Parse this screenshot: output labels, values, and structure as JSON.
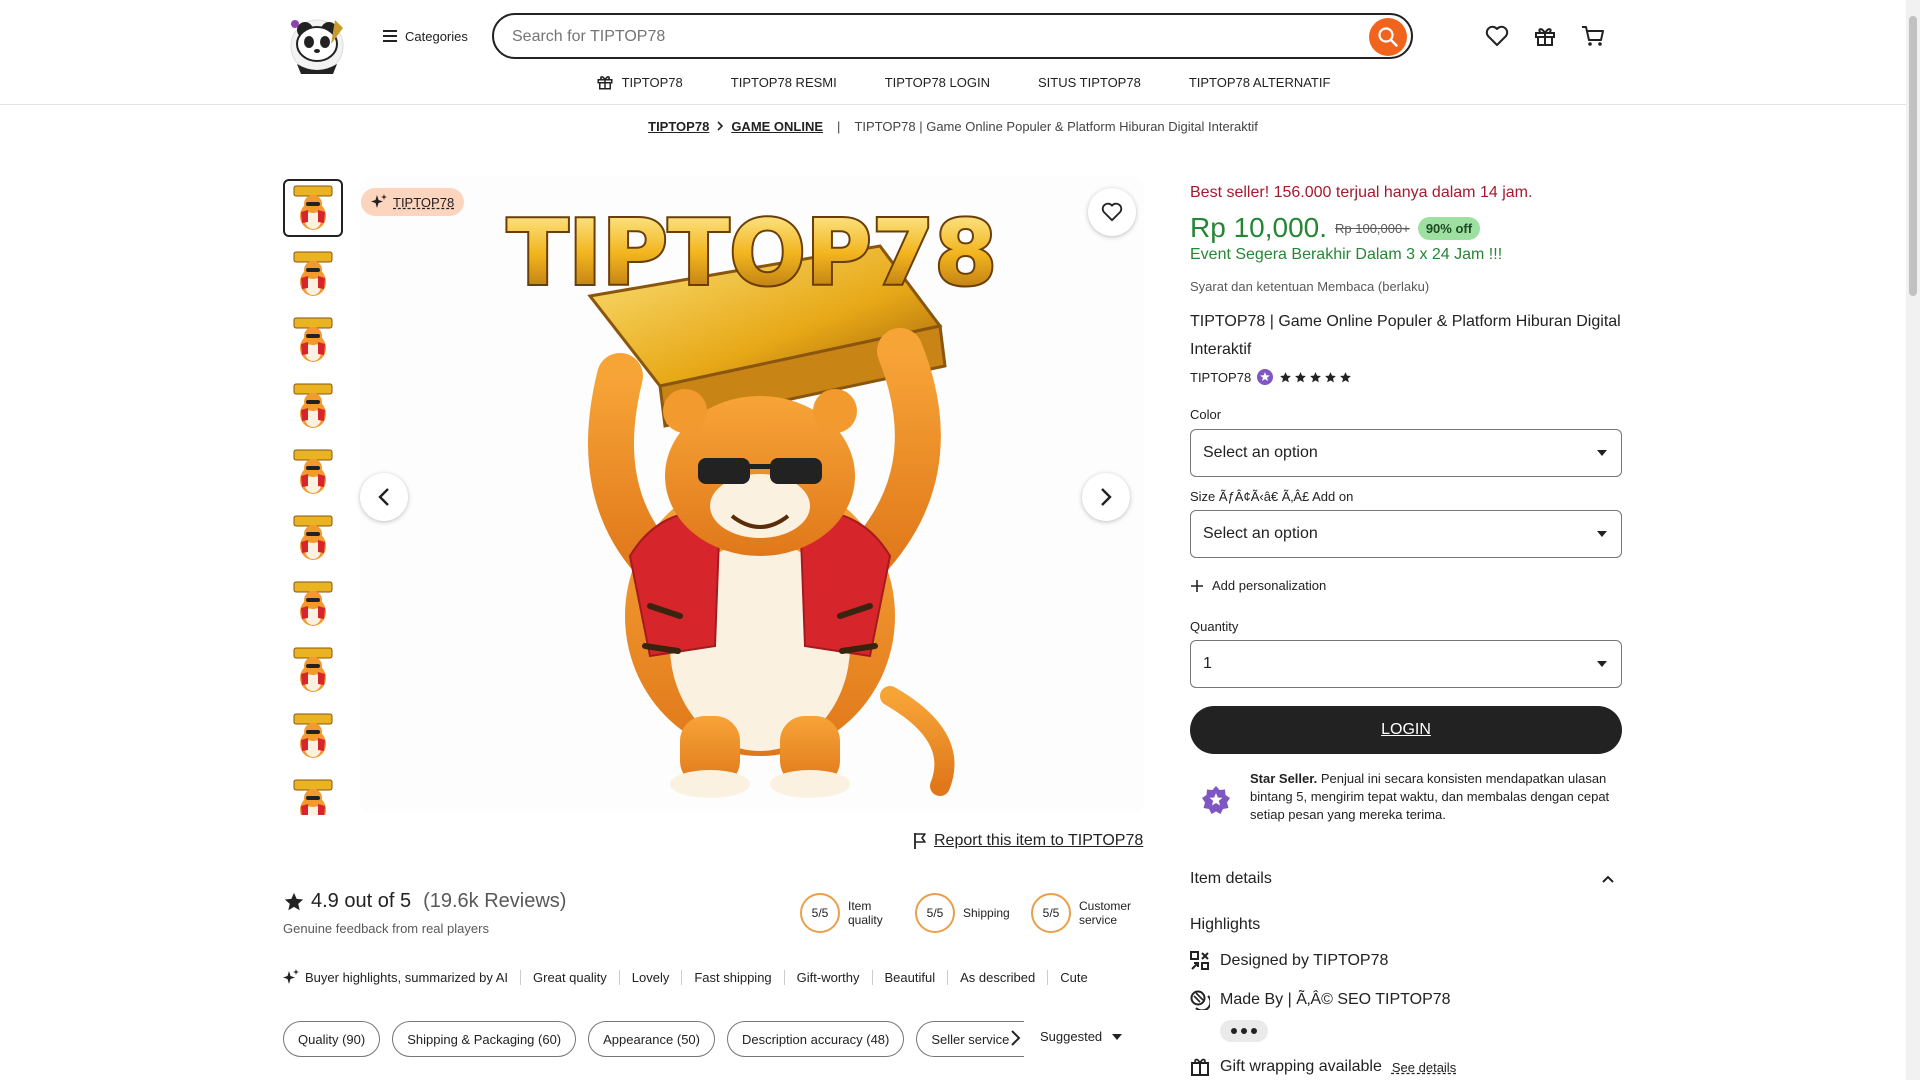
{
  "header": {
    "categories_label": "Categories",
    "search_placeholder": "Search for TIPTOP78",
    "nav": [
      {
        "label": "TIPTOP78"
      },
      {
        "label": "TIPTOP78 RESMI"
      },
      {
        "label": "TIPTOP78 LOGIN"
      },
      {
        "label": "SITUS TIPTOP78"
      },
      {
        "label": "TIPTOP78 ALTERNATIF"
      }
    ]
  },
  "breadcrumb": {
    "items": [
      "TIPTOP78",
      "GAME ONLINE"
    ],
    "separator": "|",
    "current": "TIPTOP78 | Game Online Populer & Platform Hiburan Digital Interaktif"
  },
  "gallery": {
    "tag": "TIPTOP78",
    "image_text": "TIPTOP78",
    "thumbnail_count": 10,
    "report_link": "Report this item to TIPTOP78"
  },
  "reviews": {
    "rating": "4.9 out of 5",
    "count": "(19.6k Reviews)",
    "subtitle": "Genuine feedback from real players",
    "scores": [
      {
        "value": "5/5",
        "label": "Item quality"
      },
      {
        "value": "5/5",
        "label": "Shipping"
      },
      {
        "value": "5/5",
        "label": "Customer service"
      }
    ],
    "highlights_label": "Buyer highlights, summarized by AI",
    "highlights": [
      "Great quality",
      "Lovely",
      "Fast shipping",
      "Gift-worthy",
      "Beautiful",
      "As described",
      "Cute"
    ],
    "chips": [
      "Quality (90)",
      "Shipping & Packaging (60)",
      "Appearance (50)",
      "Description accuracy (48)",
      "Seller service"
    ],
    "sort_label": "Suggested"
  },
  "product": {
    "bestseller": "Best seller! 156.000 terjual hanya dalam 14 jam.",
    "price": "Rp 10,000.",
    "old_price": "Rp 100,000+",
    "discount": "90% off",
    "event": "Event Segera Berakhir Dalam 3 x 24 Jam !!!",
    "terms": "Syarat dan ketentuan Membaca (berlaku)",
    "title": "TIPTOP78 | Game Online Populer & Platform Hiburan Digital Interaktif",
    "seller": "TIPTOP78",
    "stars": 5,
    "color_label": "Color",
    "color_value": "Select an option",
    "size_label": "Size ÃƒÂ¢Ã‹â€ Ã‚Â£ Add on",
    "size_value": "Select an option",
    "personalization": "Add personalization",
    "quantity_label": "Quantity",
    "quantity_value": "1",
    "login_button": "LOGIN",
    "star_seller_title": "Star Seller.",
    "star_seller_text": " Penjual ini secara konsisten mendapatkan ulasan bintang 5, mengirim tepat waktu, dan membalas dengan cepat setiap pesan yang mereka terima.",
    "item_details": "Item details",
    "highlights_title": "Highlights",
    "designed_by": "Designed by TIPTOP78",
    "made_by": "Made By | Ã‚Â© SEO TIPTOP78",
    "gift_wrapping": "Gift wrapping available",
    "see_details": "See details"
  },
  "colors": {
    "accent": "#f1641e",
    "price_green": "#258635",
    "bestseller_red": "#a61a2e",
    "star_purple": "#7e57c2"
  }
}
